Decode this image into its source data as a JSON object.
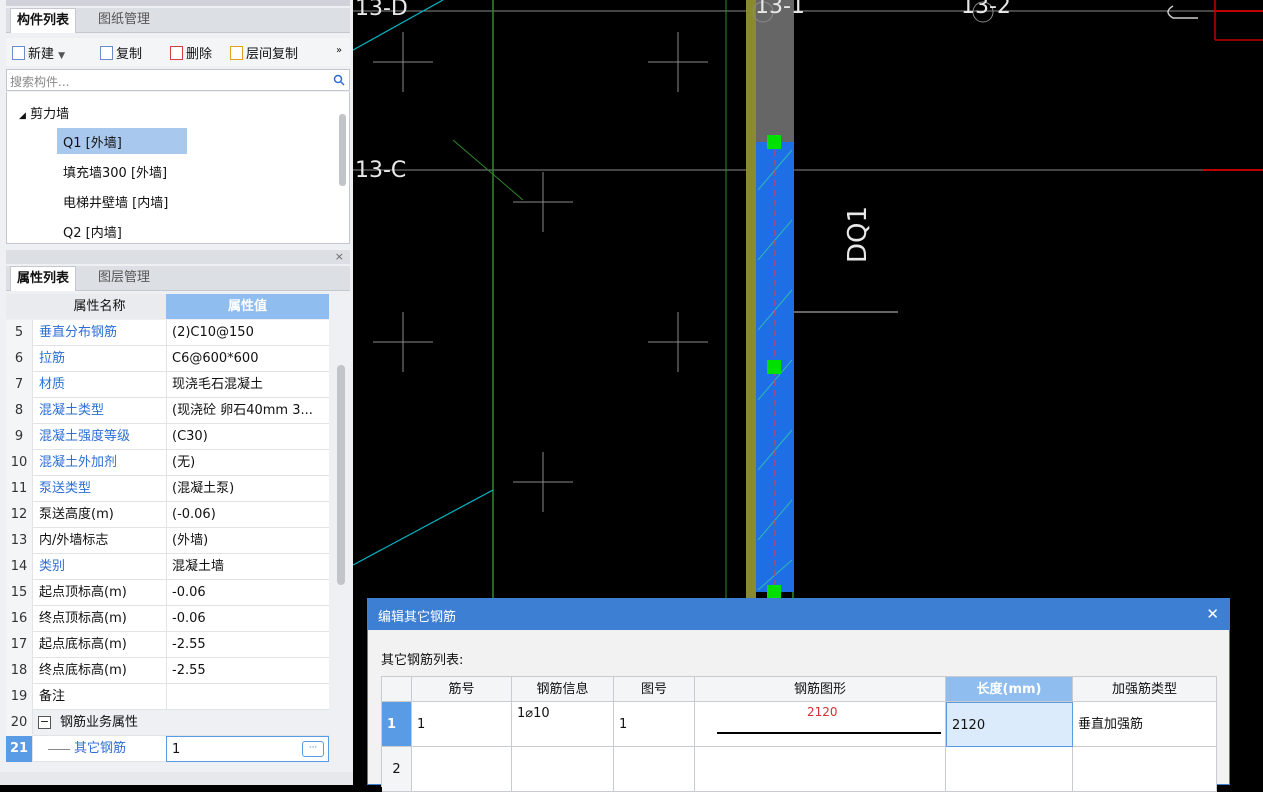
{
  "component_panel": {
    "tabs": [
      "构件列表",
      "图纸管理"
    ],
    "toolbar": {
      "new": "新建",
      "copy": "复制",
      "delete": "删除",
      "layer_copy": "层间复制"
    },
    "search_placeholder": "搜索构件...",
    "tree": {
      "category": "剪力墙",
      "items": [
        "Q1 [外墙]",
        "填充墙300 [外墙]",
        "电梯井壁墙 [内墙]",
        "Q2 [内墙]"
      ]
    }
  },
  "property_panel": {
    "tabs": [
      "属性列表",
      "图层管理"
    ],
    "headers": {
      "name": "属性名称",
      "value": "属性值"
    },
    "rows": [
      {
        "num": "5",
        "name": "垂直分布钢筋",
        "value": "(2)C10@150",
        "blue": true
      },
      {
        "num": "6",
        "name": "拉筋",
        "value": "C6@600*600",
        "blue": true
      },
      {
        "num": "7",
        "name": "材质",
        "value": "现浇毛石混凝土",
        "blue": true
      },
      {
        "num": "8",
        "name": "混凝土类型",
        "value": "(现浇砼 卵石40mm 3...",
        "blue": true
      },
      {
        "num": "9",
        "name": "混凝土强度等级",
        "value": "(C30)",
        "blue": true
      },
      {
        "num": "10",
        "name": "混凝土外加剂",
        "value": "(无)",
        "blue": true
      },
      {
        "num": "11",
        "name": "泵送类型",
        "value": "(混凝土泵)",
        "blue": true
      },
      {
        "num": "12",
        "name": "泵送高度(m)",
        "value": "(-0.06)",
        "blue": false
      },
      {
        "num": "13",
        "name": "内/外墙标志",
        "value": "(外墙)",
        "blue": false
      },
      {
        "num": "14",
        "name": "类别",
        "value": "混凝土墙",
        "blue": true
      },
      {
        "num": "15",
        "name": "起点顶标高(m)",
        "value": "-0.06",
        "blue": false
      },
      {
        "num": "16",
        "name": "终点顶标高(m)",
        "value": "-0.06",
        "blue": false
      },
      {
        "num": "17",
        "name": "起点底标高(m)",
        "value": "-2.55",
        "blue": false
      },
      {
        "num": "18",
        "name": "终点底标高(m)",
        "value": "-2.55",
        "blue": false
      },
      {
        "num": "19",
        "name": "备注",
        "value": "",
        "blue": false
      },
      {
        "num": "20",
        "name": "钢筋业务属性",
        "value": "",
        "blue": false
      },
      {
        "num": "21",
        "name": "其它钢筋",
        "value": "1",
        "blue": true
      }
    ],
    "expander": "−",
    "ellipsis": "···"
  },
  "canvas": {
    "axis_labels": [
      "13-D",
      "13-1",
      "13-2",
      "13-C",
      "DQ1"
    ]
  },
  "dialog": {
    "title": "编辑其它钢筋",
    "list_label": "其它钢筋列表:",
    "columns": [
      "筋号",
      "钢筋信息",
      "图号",
      "钢筋图形",
      "长度(mm)",
      "加强筋类型"
    ],
    "rows": [
      {
        "num": "1",
        "bar_no": "1",
        "rebar_info": "1⌀10",
        "figure_no": "1",
        "shape_value": "2120",
        "length": "2120",
        "type": "垂直加强筋"
      },
      {
        "num": "2",
        "bar_no": "",
        "rebar_info": "",
        "figure_no": "",
        "shape_value": "",
        "length": "",
        "type": ""
      }
    ]
  },
  "colors": {
    "accent": "#3d7fd3",
    "wall_fill": "#1e6fe6",
    "handle": "#00e000",
    "cad_bg": "#000000"
  }
}
